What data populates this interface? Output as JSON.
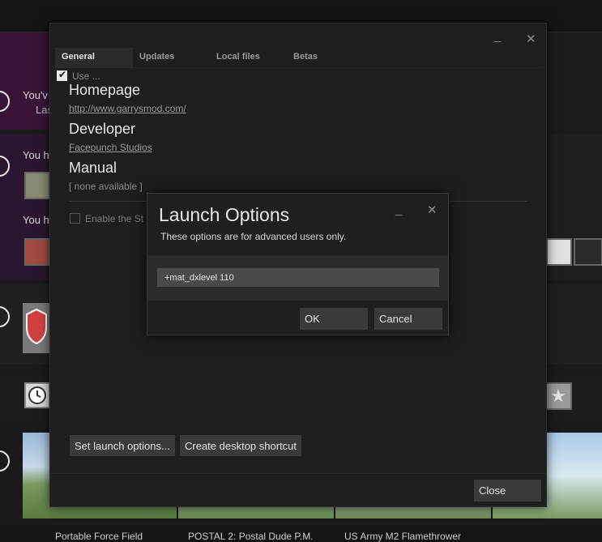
{
  "background": {
    "row1_text_a": "You'v",
    "row1_text_b": "Las",
    "row2_text_a": "You h",
    "row2_text_b": "You h",
    "bottom_labels": [
      "Portable Force Field",
      "POSTAL 2: Postal Dude P.M.",
      "US Army M2 Flamethrower"
    ]
  },
  "properties": {
    "minimize_label": "_",
    "close_label": "✕",
    "tabs": [
      {
        "label": "General",
        "active": true
      },
      {
        "label": "Updates",
        "active": false
      },
      {
        "label": "Local files",
        "active": false
      },
      {
        "label": "Betas",
        "active": false
      }
    ],
    "use_label": "Use ...",
    "homepage_heading": "Homepage",
    "homepage_link": "http://www.garrysmod.com/",
    "developer_heading": "Developer",
    "developer_link": "Facepunch Studios",
    "manual_heading": "Manual",
    "manual_value": "[ none available ]",
    "enable_label": "Enable the St",
    "set_launch_button": "Set launch options...",
    "desktop_shortcut_button": "Create desktop shortcut",
    "close_button": "Close"
  },
  "launch_options": {
    "title": "Launch Options",
    "subtitle": "These options are for advanced users only.",
    "input_value": "+mat_dxlevel 110",
    "ok_button": "OK",
    "cancel_button": "Cancel",
    "minimize_label": "_",
    "close_label": "✕"
  },
  "icons": [
    "checkbox-icon",
    "clock-icon",
    "star-icon",
    "minimize-icon",
    "close-icon",
    "shield-icon"
  ]
}
